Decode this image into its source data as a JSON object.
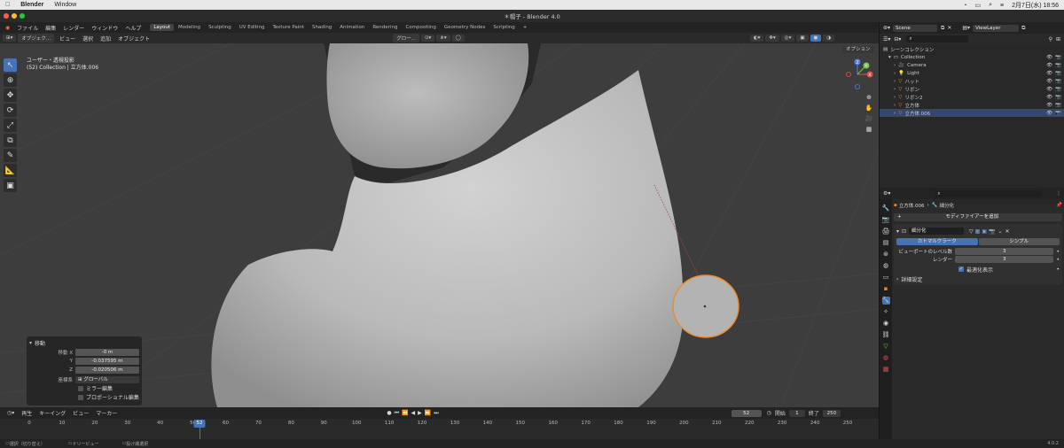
{
  "macos": {
    "apple_icon": "apple-icon",
    "app": "Blender",
    "menu": [
      "Window"
    ],
    "clock": "2月7日(水)  18:56"
  },
  "window": {
    "title": "＊帽子 - Blender 4.0"
  },
  "menubar": {
    "items": [
      "ファイル",
      "編集",
      "レンダー",
      "ウィンドウ",
      "ヘルプ"
    ],
    "workspaces": [
      "Layout",
      "Modeling",
      "Sculpting",
      "UV Editing",
      "Texture Paint",
      "Shading",
      "Animation",
      "Rendering",
      "Compositing",
      "Geometry Nodes",
      "Scripting"
    ],
    "active_workspace": "Layout",
    "add_tab": "+",
    "scene": "Scene",
    "view_layer": "ViewLayer"
  },
  "viewport": {
    "mode": "オブジェク...",
    "menus": [
      "ビュー",
      "選択",
      "追加",
      "オブジェクト"
    ],
    "transform_orientation": "グロー...",
    "options": "オプション",
    "info_line1": "ユーザー・透視投影",
    "info_line2": "(52) Collection | 立方体.006",
    "gizmo": {
      "x": "X",
      "y": "Y",
      "z": "Z"
    }
  },
  "operator_panel": {
    "title": "移動",
    "move_x_label": "移動 X",
    "y_label": "Y",
    "z_label": "Z",
    "x_value": "-0 m",
    "y_value": "-0.037595 m",
    "z_value": "-0.020506 m",
    "orientation_label": "座標系",
    "orientation_value": "グローバル",
    "mirror_edit": "ミラー編集",
    "proportional_edit": "プロポーショナル編集"
  },
  "timeline": {
    "menus": [
      "再生",
      "キーイング",
      "ビュー",
      "マーカー"
    ],
    "current_frame": "52",
    "start_label": "開始",
    "start_value": "1",
    "end_label": "終了",
    "end_value": "250",
    "ticks": [
      "0",
      "10",
      "20",
      "30",
      "40",
      "50",
      "60",
      "70",
      "80",
      "90",
      "100",
      "110",
      "120",
      "130",
      "140",
      "150",
      "160",
      "170",
      "180",
      "190",
      "200",
      "210",
      "220",
      "230",
      "240",
      "250"
    ],
    "playhead_frame": 52
  },
  "statusbar": {
    "select": "選択（切り替え）",
    "dolly": "ドリービュー",
    "lasso": "投げ縄選択",
    "version": "4.0.2"
  },
  "outliner": {
    "scene_collection": "シーンコレクション",
    "items": [
      {
        "name": "Collection",
        "icon": "collection-icon",
        "indent": 1
      },
      {
        "name": "Camera",
        "icon": "camera-icon",
        "indent": 2
      },
      {
        "name": "Light",
        "icon": "light-icon",
        "indent": 2
      },
      {
        "name": "ハット",
        "icon": "mesh-icon",
        "indent": 2
      },
      {
        "name": "リボン",
        "icon": "mesh-icon",
        "indent": 2
      },
      {
        "name": "リボン2",
        "icon": "mesh-icon",
        "indent": 2
      },
      {
        "name": "立方体",
        "icon": "mesh-icon",
        "indent": 2
      },
      {
        "name": "立方体.006",
        "icon": "mesh-icon",
        "indent": 2,
        "selected": true
      }
    ]
  },
  "properties": {
    "breadcrumb_object": "立方体.006",
    "breadcrumb_modifier": "細分化",
    "add_modifier": "モディファイアーを追加",
    "modifier_name": "細分化",
    "tab_catmull": "カトマルクラーク",
    "tab_simple": "シンプル",
    "viewport_levels_label": "ビューポートのレベル数",
    "viewport_levels_value": "3",
    "render_label": "レンダー",
    "render_value": "3",
    "optimal_display": "最適化表示",
    "advanced": "詳細設定"
  },
  "colors": {
    "accent": "#4772b3",
    "selection_outline": "#f08a2a",
    "mesh_orange": "#e8843c"
  }
}
